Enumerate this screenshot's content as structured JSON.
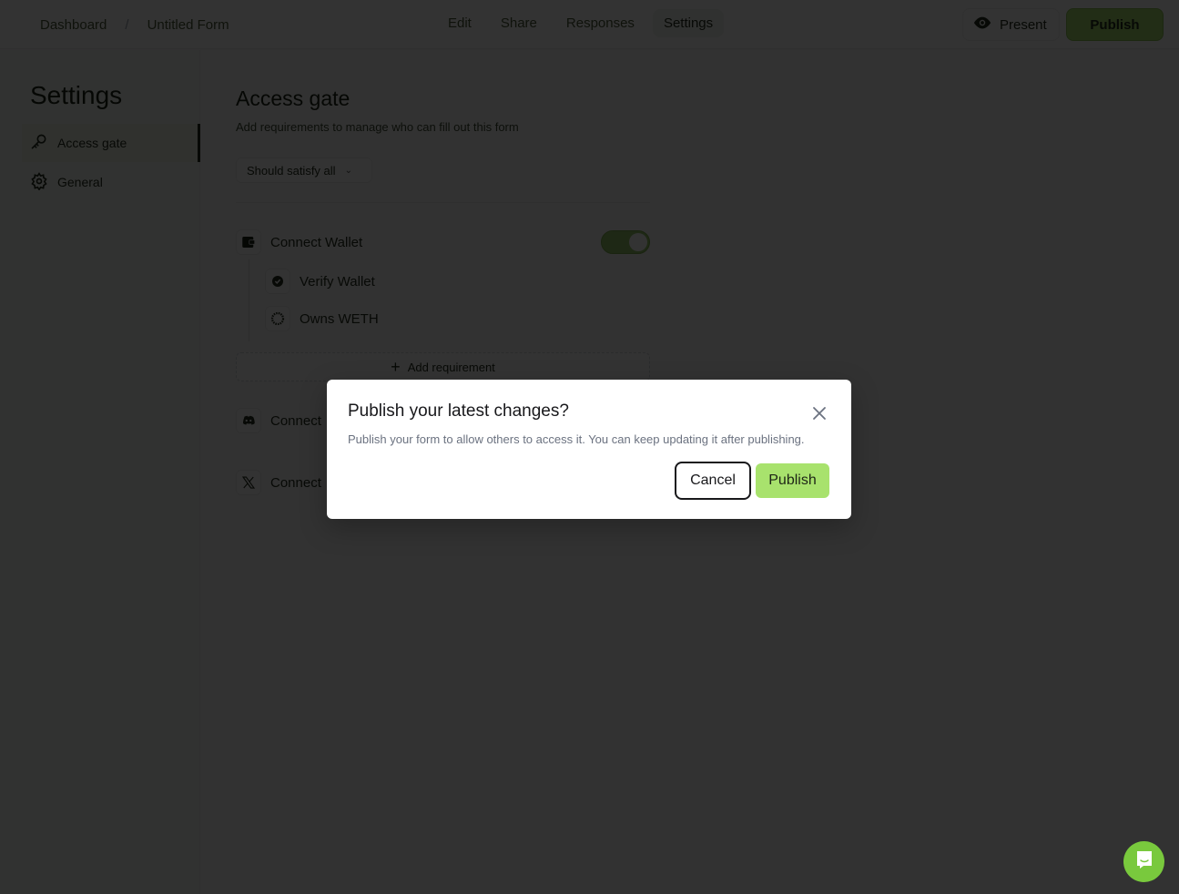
{
  "topbar": {
    "breadcrumb": [
      "Dashboard",
      "Untitled Form"
    ],
    "breadcrumb_separator": "/",
    "tabs": [
      {
        "label": "Edit",
        "active": false
      },
      {
        "label": "Share",
        "active": false
      },
      {
        "label": "Responses",
        "active": false
      },
      {
        "label": "Settings",
        "active": true
      }
    ],
    "present_label": "Present",
    "publish_label": "Publish"
  },
  "sidebar": {
    "title": "Settings",
    "items": [
      {
        "label": "Access gate",
        "icon": "key-icon",
        "active": true
      },
      {
        "label": "General",
        "icon": "gear-icon",
        "active": false
      }
    ]
  },
  "main": {
    "title": "Access gate",
    "subtitle": "Add requirements to manage who can fill out this form",
    "satisfy_select": {
      "value": "Should satisfy all"
    },
    "requirements": [
      {
        "label": "Connect Wallet",
        "icon": "wallet-icon",
        "enabled": true,
        "sub_requirements": [
          {
            "label": "Verify Wallet",
            "icon": "badge-check-icon"
          },
          {
            "label": "Owns WETH",
            "icon": "token-icon"
          }
        ],
        "add_label": "Add requirement"
      },
      {
        "label": "Connect",
        "icon": "discord-icon"
      },
      {
        "label": "Connect",
        "icon": "x-logo-icon"
      }
    ]
  },
  "modal": {
    "title": "Publish your latest changes?",
    "description": "Publish your form to allow others to access it. You can keep updating it after publishing.",
    "cancel_label": "Cancel",
    "publish_label": "Publish"
  },
  "colors": {
    "accent": "#a8e26d",
    "chat_launcher": "#79c93d"
  }
}
